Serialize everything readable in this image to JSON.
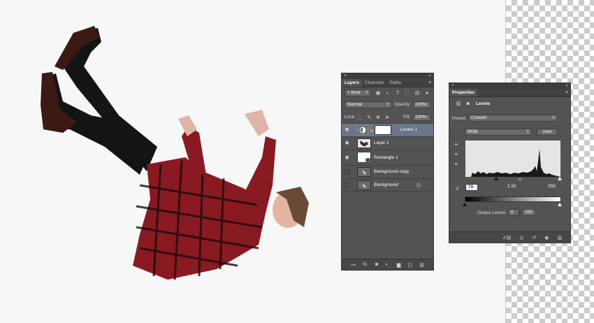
{
  "layers_panel": {
    "close": "×",
    "collapse": "«",
    "tabs": [
      "Layers",
      "Channels",
      "Paths"
    ],
    "menu": "≡",
    "filter_kind": "Kind",
    "blend_mode": "Normal",
    "opacity_label": "Opacity:",
    "opacity_value": "100%",
    "lock_label": "Lock:",
    "fill_label": "Fill:",
    "fill_value": "100%",
    "layers": [
      {
        "name": "Levels 1",
        "visible": true,
        "selected": true
      },
      {
        "name": "Layer 1",
        "visible": true,
        "selected": false
      },
      {
        "name": "Rectangle 1",
        "visible": true,
        "selected": false
      },
      {
        "name": "Background copy",
        "visible": false,
        "selected": false
      },
      {
        "name": "Background",
        "visible": false,
        "selected": false
      }
    ]
  },
  "properties_panel": {
    "close": "×",
    "collapse": "«",
    "title": "Properties",
    "menu": "≡",
    "adjustment_name": "Levels",
    "preset_label": "Preset:",
    "preset_value": "Custom",
    "channel": "RGB",
    "auto_label": "Auto",
    "input_black": "78",
    "input_gamma": "1.32",
    "input_white": "255",
    "output_label": "Output Levels:",
    "output_black": "0",
    "output_white": "255"
  }
}
